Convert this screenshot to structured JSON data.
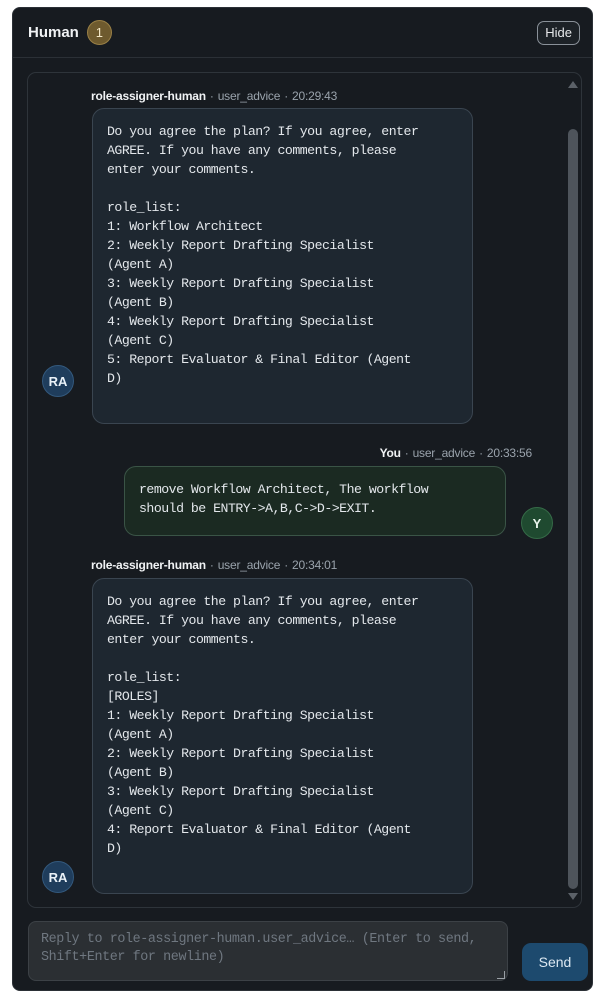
{
  "header": {
    "title": "Human",
    "count": "1",
    "hide_label": "Hide"
  },
  "messages": [
    {
      "author": "role-assigner-human",
      "channel": "user_advice",
      "time": "20:29:43",
      "avatar": "RA",
      "text": "Do you agree the plan? If you agree, enter\nAGREE. If you have any comments, please\nenter your comments.\n\nrole_list:\n1: Workflow Architect\n2: Weekly Report Drafting Specialist\n(Agent A)\n3: Weekly Report Drafting Specialist\n(Agent B)\n4: Weekly Report Drafting Specialist\n(Agent C)\n5: Report Evaluator & Final Editor (Agent\nD)"
    },
    {
      "author": "You",
      "channel": "user_advice",
      "time": "20:33:56",
      "avatar": "Y",
      "text": "remove Workflow Architect, The workflow\nshould be ENTRY->A,B,C->D->EXIT."
    },
    {
      "author": "role-assigner-human",
      "channel": "user_advice",
      "time": "20:34:01",
      "avatar": "RA",
      "text": "Do you agree the plan? If you agree, enter\nAGREE. If you have any comments, please\nenter your comments.\n\nrole_list:\n[ROLES]\n1: Weekly Report Drafting Specialist\n(Agent A)\n2: Weekly Report Drafting Specialist\n(Agent B)\n3: Weekly Report Drafting Specialist\n(Agent C)\n4: Report Evaluator & Final Editor (Agent\nD)"
    }
  ],
  "meta_separator": "·",
  "composer": {
    "placeholder": "Reply to role-assigner-human.user_advice… (Enter to send, Shift+Enter for newline)",
    "value": "",
    "send_label": "Send"
  },
  "icons": {
    "scroll_up": "scroll-up-arrow-icon",
    "scroll_down": "scroll-down-arrow-icon",
    "resize": "resize-grip-icon"
  },
  "colors": {
    "panel_bg": "#171b20",
    "agent_bubble": "#1e2730",
    "user_bubble": "#1b2a22",
    "badge": "#6e5a2e",
    "send_button": "#1d4a6e",
    "agent_avatar": "#1f3d5c",
    "user_avatar": "#1f4a30"
  }
}
